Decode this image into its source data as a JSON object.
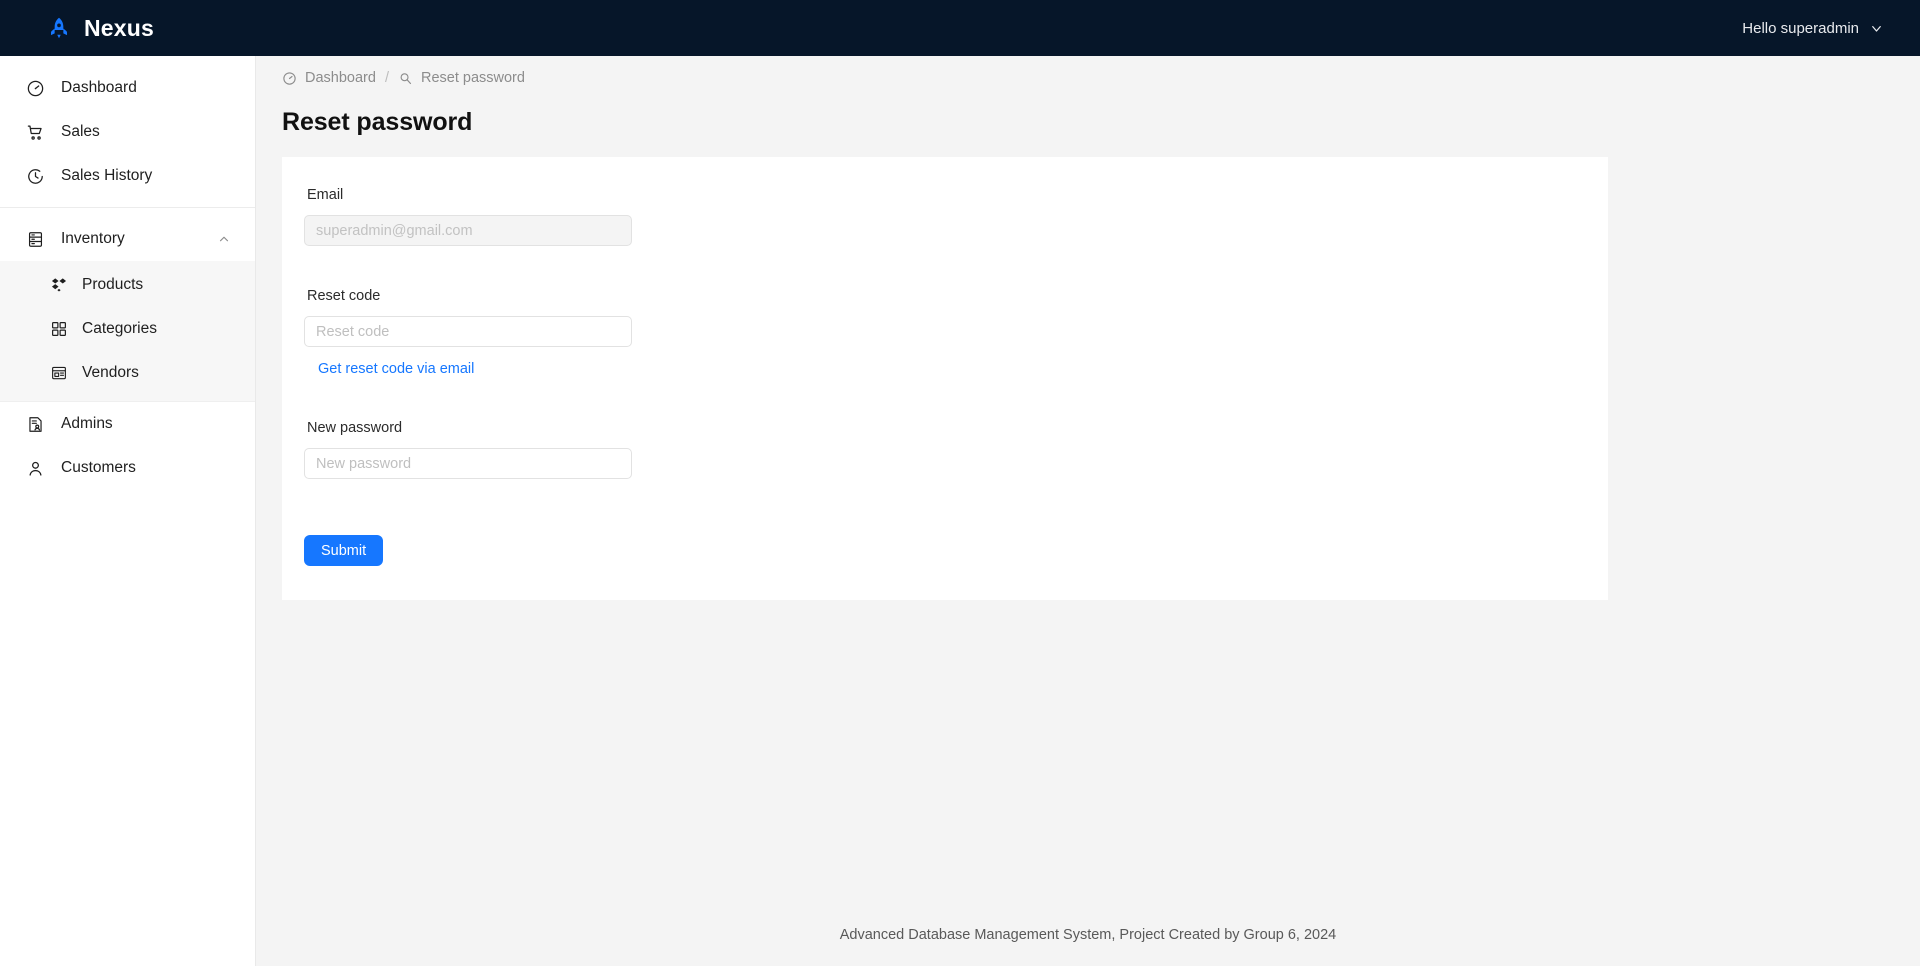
{
  "header": {
    "brand_name": "Nexus",
    "brand_icon": "rocket-icon",
    "user_greeting": "Hello superadmin",
    "user_caret_icon": "chevron-down-icon",
    "background": "#061629",
    "accent": "#1677ff"
  },
  "sidebar": {
    "items": [
      {
        "label": "Dashboard",
        "icon": "gauge-icon"
      },
      {
        "label": "Sales",
        "icon": "shopping-cart-icon"
      },
      {
        "label": "Sales History",
        "icon": "clock-history-icon"
      },
      {
        "label": "Inventory",
        "icon": "database-icon",
        "caret_icon": "chevron-up-icon",
        "expanded": true
      },
      {
        "label": "Admins",
        "icon": "admin-document-icon"
      },
      {
        "label": "Customers",
        "icon": "user-icon"
      }
    ],
    "inventory_children": [
      {
        "label": "Products",
        "icon": "products-box-icon"
      },
      {
        "label": "Categories",
        "icon": "grid-squares-icon"
      },
      {
        "label": "Vendors",
        "icon": "storefront-icon"
      }
    ]
  },
  "breadcrumb": {
    "items": [
      {
        "label": "Dashboard",
        "icon": "gauge-icon"
      },
      {
        "label": "Reset password",
        "icon": "magnifier-icon"
      }
    ],
    "separator": "/"
  },
  "main": {
    "page_title": "Reset password",
    "fields": {
      "email": {
        "label": "Email",
        "value": "",
        "placeholder": "superadmin@gmail.com",
        "disabled": true
      },
      "reset_code": {
        "label": "Reset code",
        "value": "",
        "placeholder": "Reset code",
        "disabled": false
      },
      "new_password": {
        "label": "New password",
        "value": "",
        "placeholder": "New password",
        "disabled": false
      }
    },
    "get_code_link": "Get reset code via email",
    "submit_label": "Submit"
  },
  "footer": {
    "text": "Advanced Database Management System, Project Created by Group 6, 2024"
  }
}
